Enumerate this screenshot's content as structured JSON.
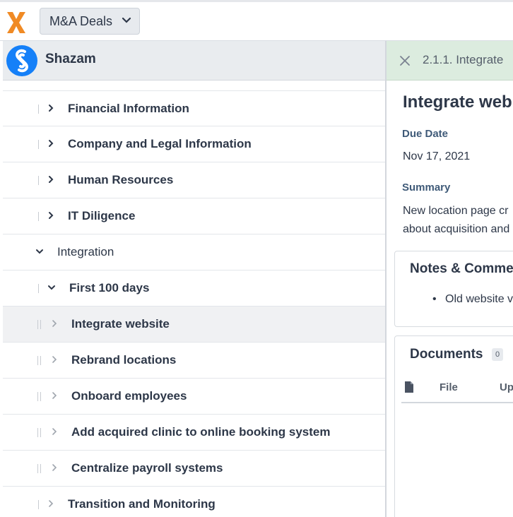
{
  "topbar": {
    "logo_icon": "x-logo-icon",
    "deal_selector": "M&A Deals",
    "accent_color": "#f08a24"
  },
  "left_panel": {
    "company": {
      "name": "Shazam",
      "icon": "shazam-logo-icon",
      "icon_color": "#1580f8"
    },
    "tree": [
      {
        "label": "Financial Information",
        "level": 1,
        "expanded": false,
        "bold": true
      },
      {
        "label": "Company and Legal Information",
        "level": 1,
        "expanded": false,
        "bold": true
      },
      {
        "label": "Human Resources",
        "level": 1,
        "expanded": false,
        "bold": true
      },
      {
        "label": "IT Diligence",
        "level": 1,
        "expanded": false,
        "bold": true
      },
      {
        "label": "Integration",
        "level": 0,
        "expanded": true,
        "bold": false
      },
      {
        "label": "First 100 days",
        "level": 1,
        "expanded": true,
        "bold": true
      },
      {
        "label": "Integrate website",
        "level": 2,
        "selected": true,
        "bold": true
      },
      {
        "label": "Rebrand locations",
        "level": 2,
        "bold": true
      },
      {
        "label": "Onboard employees",
        "level": 2,
        "bold": true
      },
      {
        "label": "Add acquired clinic to online booking system",
        "level": 2,
        "bold": true
      },
      {
        "label": "Centralize payroll systems",
        "level": 2,
        "bold": true
      },
      {
        "label": "Transition and Monitoring",
        "level": 1,
        "expanded": false,
        "bold": true
      }
    ]
  },
  "detail_panel": {
    "breadcrumb": "2.1.1. Integrate",
    "title": "Integrate web",
    "due_date_label": "Due Date",
    "due_date": "Nov 17, 2021",
    "summary_label": "Summary",
    "summary_line1": "New location page cr",
    "summary_line2": "about acquisition and",
    "notes_title": "Notes & Comme",
    "notes_bullet": "Old website v",
    "documents_title": "Documents",
    "documents_count": "0",
    "columns": {
      "file": "File",
      "uploaded": "Up"
    },
    "header_color": "#dcecdf"
  }
}
